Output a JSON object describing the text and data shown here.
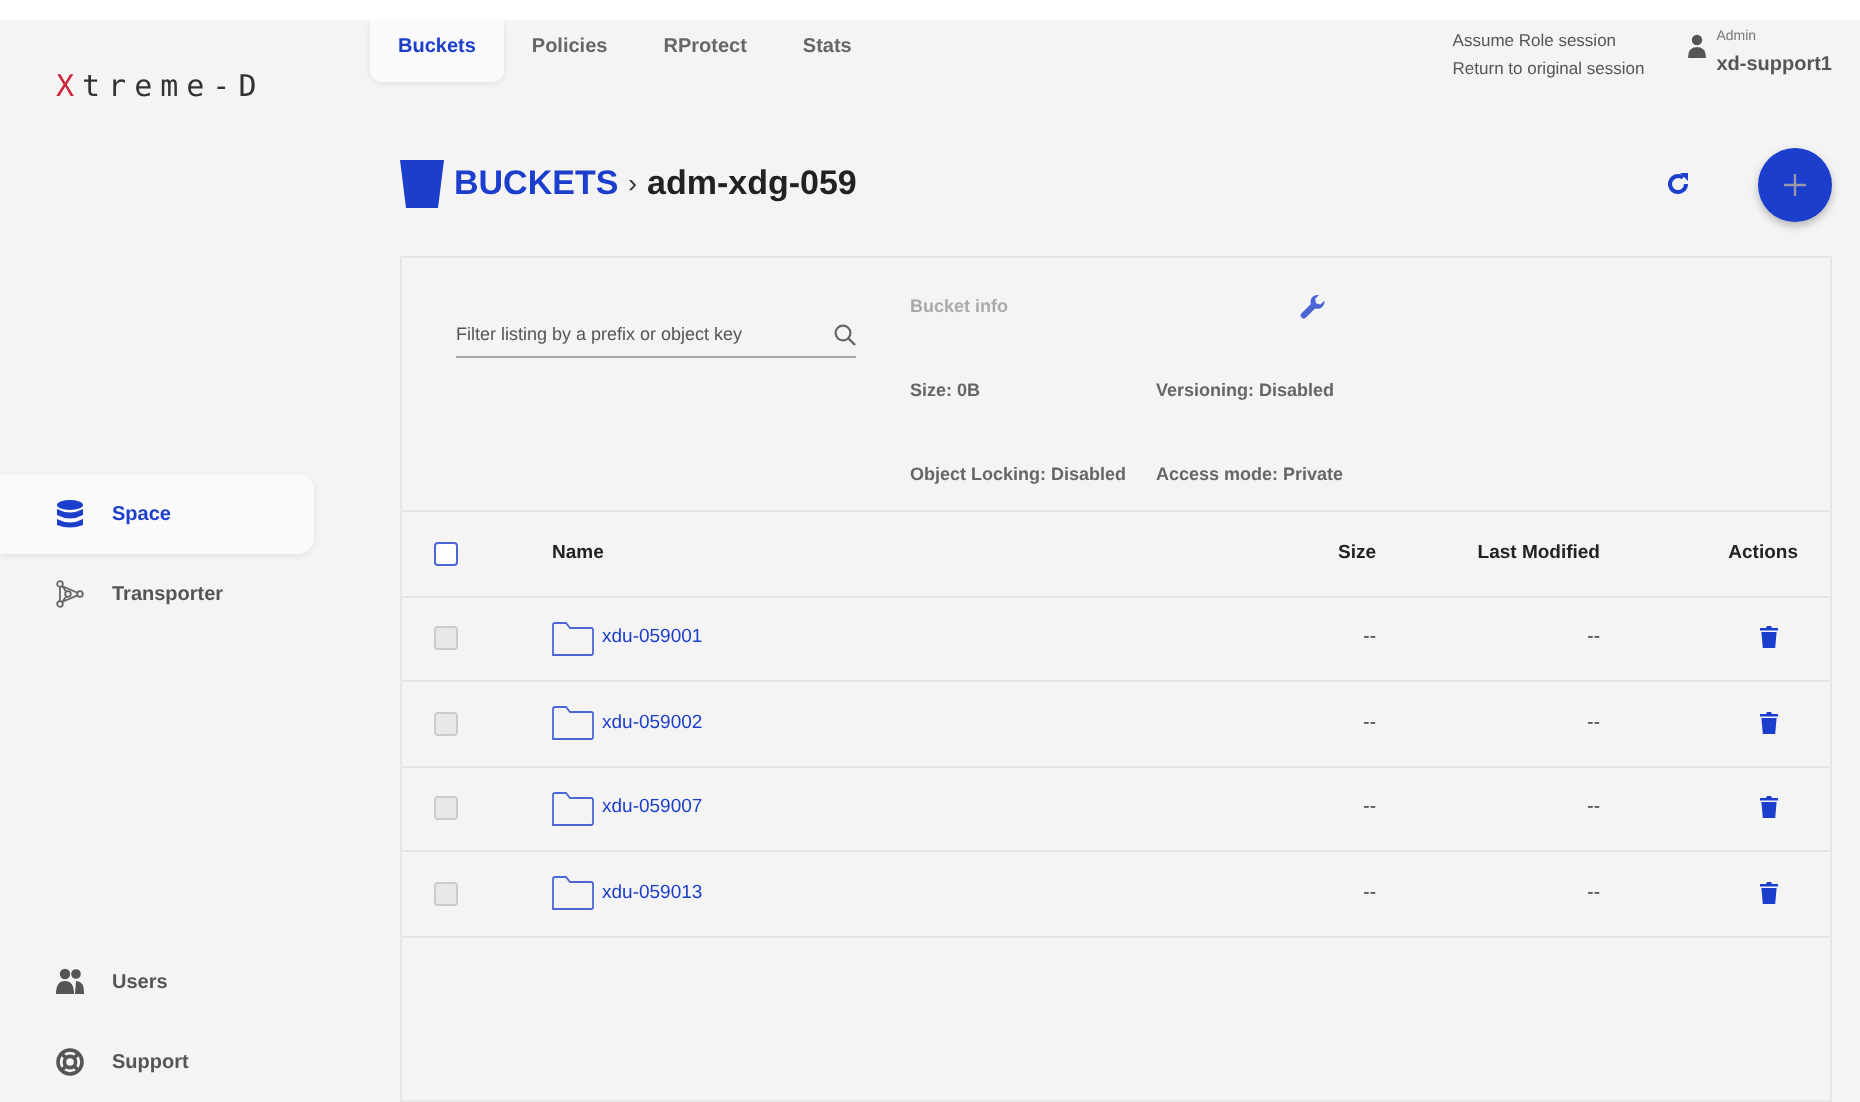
{
  "logo": "Xtreme-D",
  "tabs": [
    {
      "label": "Buckets",
      "selected": true
    },
    {
      "label": "Policies",
      "selected": false
    },
    {
      "label": "RProtect",
      "selected": false
    },
    {
      "label": "Stats",
      "selected": false
    }
  ],
  "session": {
    "title": "Assume Role session",
    "link": "Return to original session"
  },
  "user": {
    "role": "Admin",
    "name": "xd-support1"
  },
  "sidebar": {
    "items": [
      {
        "label": "Space",
        "kind": "space",
        "selected": true
      },
      {
        "label": "Transporter",
        "kind": "transporter",
        "selected": false
      }
    ],
    "bottom_items": [
      {
        "label": "Users",
        "kind": "users"
      },
      {
        "label": "Support",
        "kind": "support"
      }
    ]
  },
  "breadcrumb": {
    "root": "BUCKETS",
    "separator": "›",
    "current": "adm-xdg-059"
  },
  "filter": {
    "placeholder": "Filter listing by a prefix or object key"
  },
  "bucket_info": {
    "title": "Bucket info",
    "items": [
      "Size: 0B",
      "Versioning: Disabled",
      "Object Locking: Disabled",
      "Access mode: Private"
    ]
  },
  "table": {
    "select_all": {
      "checked": false,
      "disabled": false
    },
    "columns": [
      "Name",
      "Size",
      "Last Modified",
      "Actions"
    ],
    "rows": [
      {
        "name": "xdu-059001",
        "size": "--",
        "last_modified": "--",
        "checked": false,
        "disabled": true
      },
      {
        "name": "xdu-059002",
        "size": "--",
        "last_modified": "--",
        "checked": false,
        "disabled": true
      },
      {
        "name": "xdu-059007",
        "size": "--",
        "last_modified": "--",
        "checked": false,
        "disabled": true
      },
      {
        "name": "xdu-059013",
        "size": "--",
        "last_modified": "--",
        "checked": false,
        "disabled": true
      }
    ]
  }
}
